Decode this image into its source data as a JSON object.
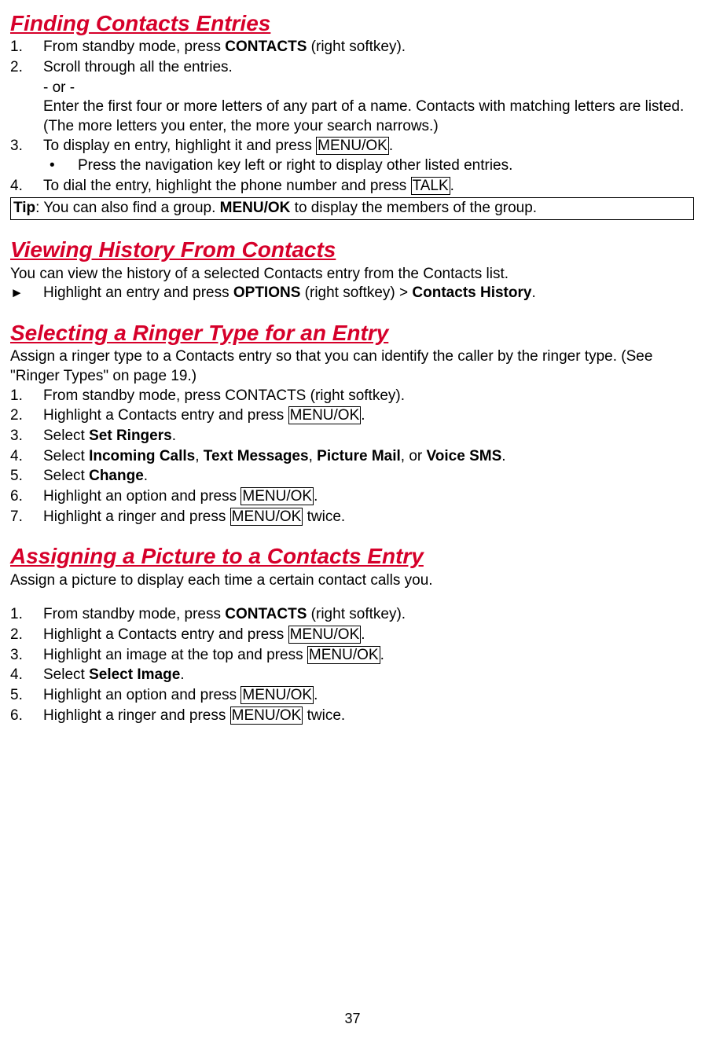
{
  "sections": {
    "finding": {
      "title": "Finding Contacts Entries",
      "steps": {
        "s1_num": "1.",
        "s1_a": "From standby mode, press ",
        "s1_b": "CONTACTS",
        "s1_c": " (right softkey).",
        "s2_num": "2.",
        "s2": "Scroll through all the entries.",
        "or": "- or -",
        "s2_alt": "Enter the first four or more letters of any part of a name. Contacts with matching letters are listed. (The more letters you enter, the more your search narrows.)",
        "s3_num": "3.",
        "s3_a": "To display en entry, highlight it and press ",
        "s3_key": "MENU/OK",
        "s3_b": ".",
        "bullet_sym": "•",
        "bullet": "Press the navigation key left or right to display other listed entries.",
        "s4_num": "4.",
        "s4_a": "To dial the entry, highlight the phone number and press ",
        "s4_key": "TALK",
        "s4_b": "."
      },
      "tip": {
        "label": "Tip",
        "a": ": You can also find a group. ",
        "b": "MENU/OK",
        "c": " to display the members of the group."
      }
    },
    "viewing": {
      "title": "Viewing History From Contacts",
      "p": "You can view the history of a selected Contacts entry from the Contacts list.",
      "arrow": "►",
      "line_a": "Highlight an entry and press ",
      "line_b": "OPTIONS",
      "line_c": " (right softkey) > ",
      "line_d": "Contacts History",
      "line_e": "."
    },
    "ringer": {
      "title": "Selecting a Ringer Type for an Entry",
      "p": "Assign a ringer type to a Contacts entry so that you can identify the caller by the ringer type. (See \"Ringer Types\" on page 19.)",
      "s1_num": "1.",
      "s1": "From standby mode, press CONTACTS (right softkey).",
      "s2_num": "2.",
      "s2_a": "Highlight a Contacts entry and press ",
      "s2_key": "MENU/OK",
      "s2_b": ".",
      "s3_num": "3.",
      "s3_a": "Select ",
      "s3_b": "Set Ringers",
      "s3_c": ".",
      "s4_num": "4.",
      "s4_a": "Select ",
      "s4_b": "Incoming Calls",
      "s4_c": ", ",
      "s4_d": "Text Messages",
      "s4_e": ", ",
      "s4_f": "Picture Mail",
      "s4_g": ", or ",
      "s4_h": "Voice SMS",
      "s4_i": ".",
      "s5_num": "5.",
      "s5_a": "Select ",
      "s5_b": "Change",
      "s5_c": ".",
      "s6_num": "6.",
      "s6_a": "Highlight an option and press ",
      "s6_key": "MENU/OK",
      "s6_b": ".",
      "s7_num": "7.",
      "s7_a": "Highlight a ringer and press ",
      "s7_key": "MENU/OK",
      "s7_b": " twice."
    },
    "picture": {
      "title": "Assigning a Picture to a Contacts Entry",
      "p": "Assign a picture to display each time a certain contact calls you.",
      "s1_num": "1.",
      "s1_a": "From standby mode, press ",
      "s1_b": "CONTACTS",
      "s1_c": " (right softkey).",
      "s2_num": "2.",
      "s2_a": "Highlight a Contacts entry and press ",
      "s2_key": "MENU/OK",
      "s2_b": ".",
      "s3_num": "3.",
      "s3_a": "Highlight an image at the top and press ",
      "s3_key": "MENU/OK",
      "s3_b": ".",
      "s4_num": "4.",
      "s4_a": "Select ",
      "s4_b": "Select Image",
      "s4_c": ".",
      "s5_num": "5.",
      "s5_a": "Highlight an option and press ",
      "s5_key": "MENU/OK",
      "s5_b": ".",
      "s6_num": "6.",
      "s6_a": "Highlight a ringer and press ",
      "s6_key": "MENU/OK",
      "s6_b": " twice."
    }
  },
  "page_number": "37"
}
